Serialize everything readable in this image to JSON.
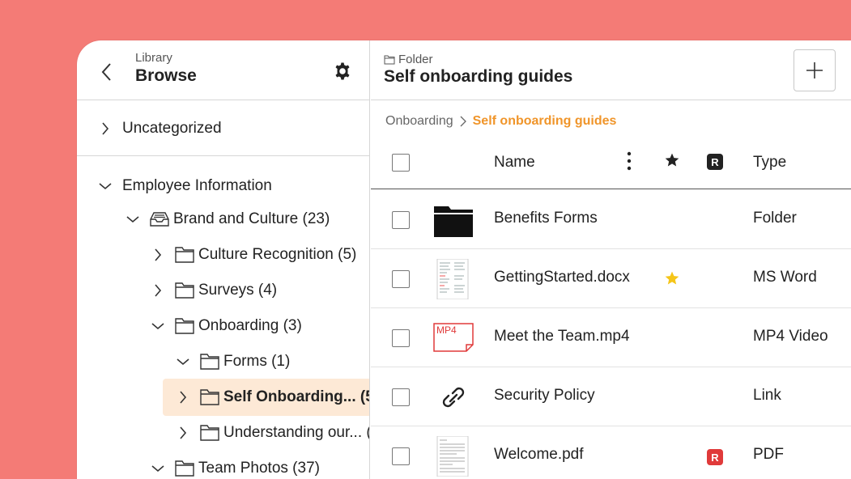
{
  "sidebar": {
    "subtitle": "Library",
    "title": "Browse",
    "uncategorized": "Uncategorized",
    "tree": [
      {
        "label": "Employee Information"
      },
      {
        "label": "Brand and Culture (23)"
      },
      {
        "label": "Culture Recognition (5)"
      },
      {
        "label": "Surveys (4)"
      },
      {
        "label": "Onboarding (3)"
      },
      {
        "label": "Forms (1)"
      },
      {
        "label": "Self Onboarding... (5"
      },
      {
        "label": "Understanding our... ("
      },
      {
        "label": "Team Photos (37)"
      }
    ]
  },
  "main": {
    "subtitle": "Folder",
    "title": "Self onboarding guides",
    "breadcrumb": {
      "parent": "Onboarding",
      "current": "Self onboarding guides"
    },
    "columns": {
      "name": "Name",
      "type": "Type",
      "r_badge": "R"
    },
    "rows": [
      {
        "name": "Benefits Forms",
        "type": "Folder",
        "icon": "folder-icon",
        "starred": false,
        "r": false
      },
      {
        "name": "GettingStarted.docx",
        "type": "MS Word",
        "icon": "docx-thumbnail",
        "starred": true,
        "r": false
      },
      {
        "name": "Meet the Team.mp4",
        "type": "MP4 Video",
        "icon": "mp4-file-icon",
        "thumb_label": "MP4",
        "starred": false,
        "r": false
      },
      {
        "name": "Security Policy",
        "type": "Link",
        "icon": "link-icon",
        "starred": false,
        "r": false
      },
      {
        "name": "Welcome.pdf",
        "type": "PDF",
        "icon": "pdf-thumbnail",
        "starred": false,
        "r": true
      }
    ]
  },
  "colors": {
    "background": "#f47b76",
    "accent": "#f0952a",
    "selected_row": "#fde9d6",
    "star": "#f5c518",
    "r_badge_header": "#222222",
    "r_badge_row": "#e03a3a",
    "mp4": "#e03a3a"
  }
}
